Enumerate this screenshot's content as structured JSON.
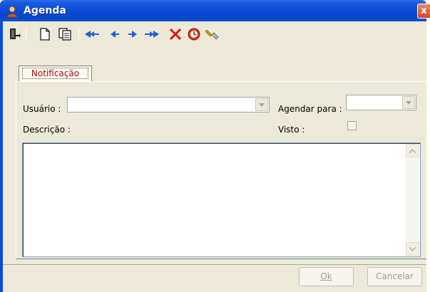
{
  "window": {
    "title": "Agenda",
    "close_glyph": "x"
  },
  "toolbar": {
    "items": [
      {
        "name": "exit-icon",
        "color": "#1a1a1a"
      },
      {
        "name": "new-document-icon",
        "color": "#1a1a1a"
      },
      {
        "name": "copy-document-icon",
        "color": "#1a1a1a"
      },
      {
        "name": "first-record-icon",
        "color": "#1f5fd6"
      },
      {
        "name": "previous-record-icon",
        "color": "#1f5fd6"
      },
      {
        "name": "next-record-icon",
        "color": "#1f5fd6"
      },
      {
        "name": "last-record-icon",
        "color": "#1f5fd6"
      },
      {
        "name": "delete-icon",
        "color": "#e01010"
      },
      {
        "name": "cancel-clock-icon",
        "color": "#cc2a10"
      },
      {
        "name": "search-flashlight-icon",
        "color": "#d4a017"
      }
    ]
  },
  "tabs": [
    {
      "label": "Notificação",
      "active": true
    }
  ],
  "form": {
    "usuario_label": "Usuário :",
    "usuario_value": "",
    "agendar_para_label": "Agendar para :",
    "agendar_para_value": "",
    "descricao_label": "Descrição :",
    "descricao_value": "",
    "visto_label": "Visto :",
    "visto_checked": false
  },
  "buttons": {
    "ok_label": "Ok",
    "cancelar_label": "Cancelar"
  },
  "colors": {
    "title_bar": "#0a4bd6",
    "tab_text": "#a01010",
    "disabled_text": "#a19f94"
  }
}
